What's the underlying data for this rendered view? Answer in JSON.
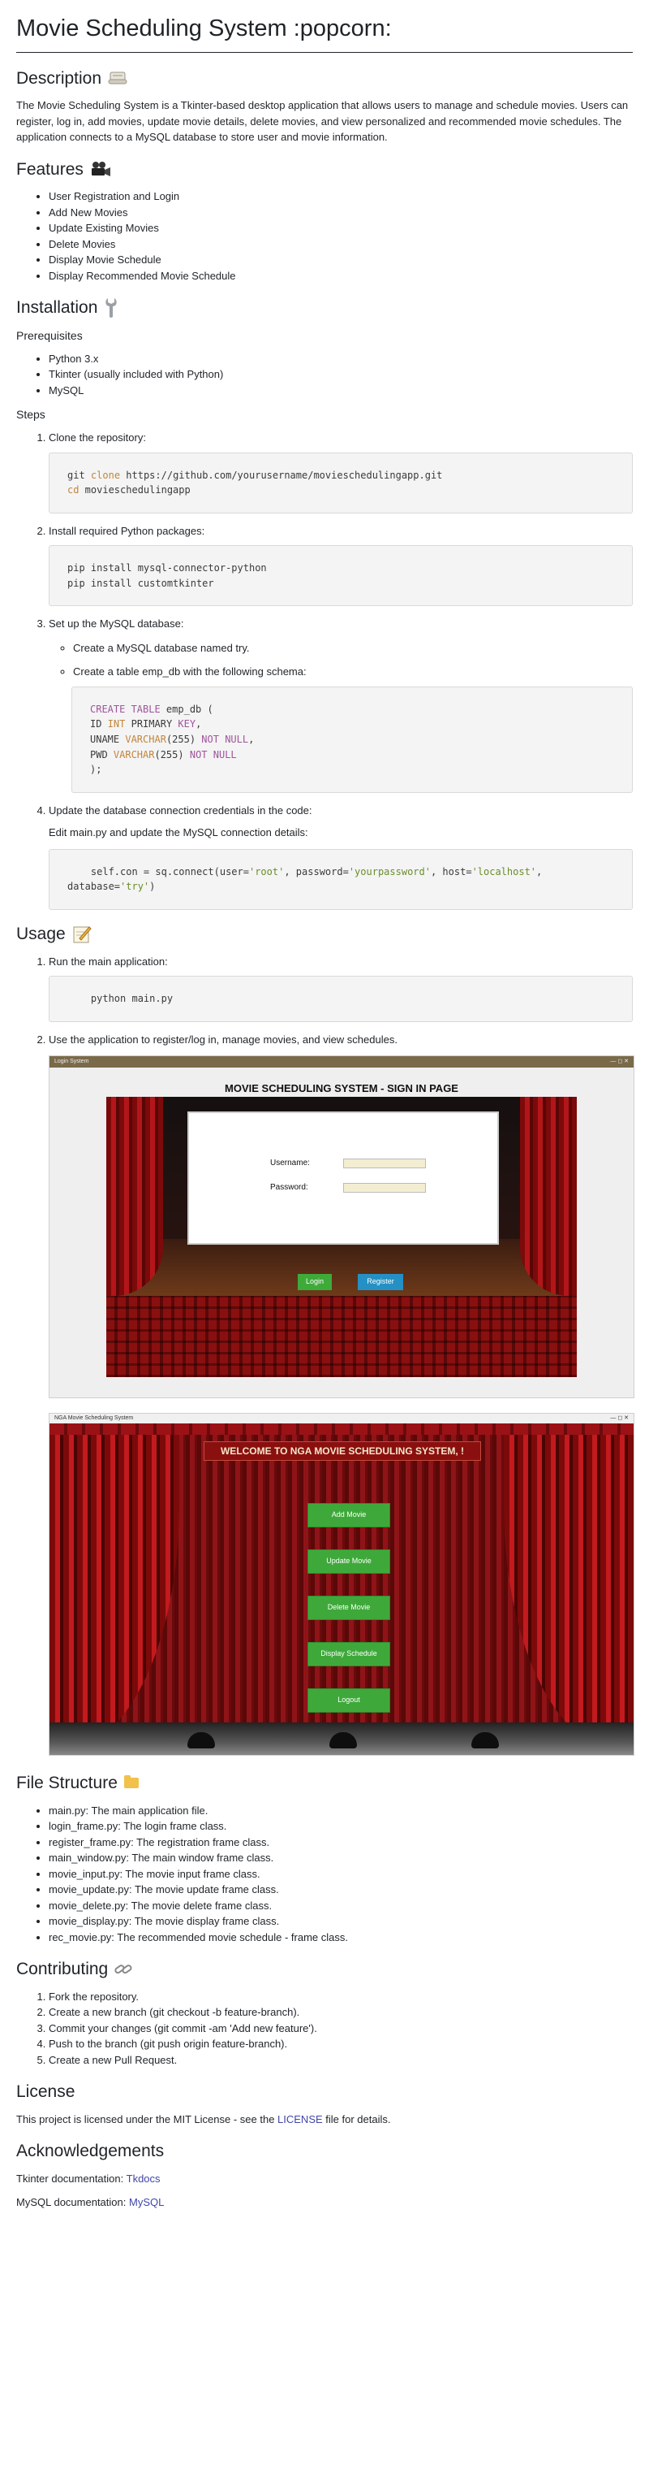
{
  "title": "Movie Scheduling System :popcorn:",
  "description": {
    "heading": "Description",
    "text": "The Movie Scheduling System is a Tkinter-based desktop application that allows users to manage and schedule movies. Users can register, log in, add movies, update movie details, delete movies, and view personalized and recommended movie schedules. The application connects to a MySQL database to store user and movie information."
  },
  "features": {
    "heading": "Features",
    "items": [
      "User Registration and Login",
      "Add New Movies",
      "Update Existing Movies",
      "Delete Movies",
      "Display Movie Schedule",
      "Display Recommended Movie Schedule"
    ]
  },
  "installation": {
    "heading": "Installation",
    "prereq_heading": "Prerequisites",
    "prereqs": [
      "Python 3.x",
      "Tkinter (usually included with Python)",
      "MySQL"
    ],
    "steps_heading": "Steps",
    "step1": "Clone the repository:",
    "step1_code_a": "git",
    "step1_code_b": "clone",
    "step1_code_c": " https://github.com/yourusername/movieschedulingapp.git",
    "step1_code_d": "cd",
    "step1_code_e": " movieschedulingapp",
    "step2": "Install required Python packages:",
    "step2_code_1": "pip install mysql-connector-python",
    "step2_code_2": "pip install customtkinter",
    "step3": "Set up the MySQL database:",
    "step3_sub1": "Create a MySQL database named try.",
    "step3_sub2": "Create a table emp_db with the following schema:",
    "sql_create": "CREATE TABLE",
    "sql_table": " emp_db (",
    "sql_id": "ID ",
    "sql_int": "INT",
    "sql_pk": " PRIMARY ",
    "sql_key": "KEY",
    "sql_comma": ",",
    "sql_uname": "UNAME ",
    "sql_varchar": "VARCHAR",
    "sql_255": "(255) ",
    "sql_notnull": "NOT NULL",
    "sql_pwd": "PWD ",
    "sql_end": ");",
    "step4": "Update the database connection credentials in the code:",
    "step4_note": "Edit main.py and update the MySQL connection details:",
    "conn_a": "self.con = sq.connect(user=",
    "conn_user": "'root'",
    "conn_b": ", password=",
    "conn_pass": "'yourpassword'",
    "conn_c": ", host=",
    "conn_host": "'localhost'",
    "conn_d": ",",
    "conn_e": "database=",
    "conn_db": "'try'",
    "conn_f": ")"
  },
  "usage": {
    "heading": "Usage",
    "step1": "Run the main application:",
    "step1_code": "python main.py",
    "step2": "Use the application to register/log in, manage movies, and view schedules."
  },
  "signin_shot": {
    "window_title": "Login System",
    "window_controls": "—  ◻  ✕",
    "heading": "MOVIE SCHEDULING SYSTEM - SIGN IN PAGE",
    "username_label": "Username:",
    "password_label": "Password:",
    "login_label": "Login",
    "register_label": "Register"
  },
  "main_shot": {
    "window_title": "NGA Movie Scheduling System",
    "window_controls": "—  ◻  ✕",
    "welcome": "WELCOME TO NGA MOVIE SCHEDULING SYSTEM, !",
    "buttons": [
      "Add Movie",
      "Update Movie",
      "Delete Movie",
      "Display Schedule",
      "Logout"
    ]
  },
  "file_structure": {
    "heading": "File Structure",
    "items": [
      "main.py: The main application file.",
      "login_frame.py: The login frame class.",
      "register_frame.py: The registration frame class.",
      "main_window.py: The main window frame class.",
      "movie_input.py: The movie input frame class.",
      "movie_update.py: The movie update frame class.",
      "movie_delete.py: The movie delete frame class.",
      "movie_display.py: The movie display frame class.",
      "rec_movie.py: The recommended movie schedule - frame class."
    ]
  },
  "contributing": {
    "heading": "Contributing",
    "items": [
      "Fork the repository.",
      "Create a new branch (git checkout -b feature-branch).",
      "Commit your changes (git commit -am 'Add new feature').",
      "Push to the branch (git push origin feature-branch).",
      "Create a new Pull Request."
    ]
  },
  "license": {
    "heading": "License",
    "text_before": "This project is licensed under the MIT License - see the ",
    "link": "LICENSE",
    "text_after": " file for details."
  },
  "acknowledgements": {
    "heading": "Acknowledgements",
    "tk_label": "Tkinter documentation: ",
    "tk_link": "Tkdocs",
    "mysql_label": "MySQL documentation: ",
    "mysql_link": "MySQL"
  }
}
